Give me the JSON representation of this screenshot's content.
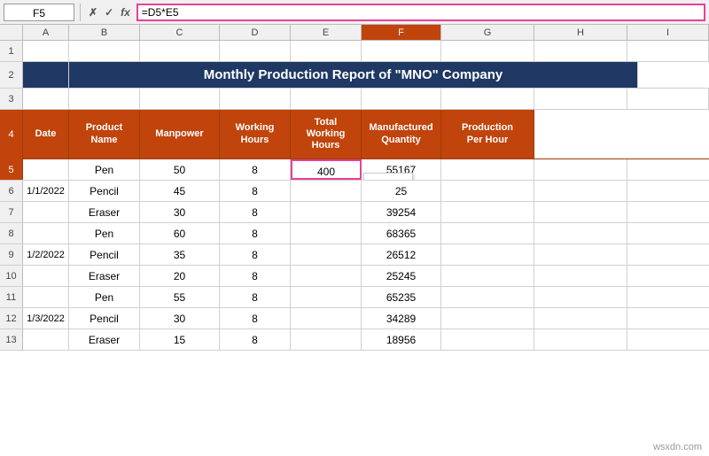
{
  "namebox": {
    "value": "F5"
  },
  "formulabar": {
    "value": "=D5*E5"
  },
  "title": {
    "text": "Monthly Production Report of \"MNO\" Company"
  },
  "headers": {
    "colLetters": [
      "",
      "A",
      "B",
      "C",
      "D",
      "E",
      "F",
      "G",
      "H",
      "I"
    ],
    "date": "Date",
    "productName": "Product\nName",
    "manpower": "Manpower",
    "workingHours": "Working\nHours",
    "totalWorkingHours": "Total\nWorking\nHours",
    "manufacturedQty": "Manufactured\nQuantity",
    "productionPerHour": "Production\nPer Hour"
  },
  "rows": [
    {
      "rowNum": "1",
      "date": "",
      "product": "",
      "manpower": "",
      "workingHours": "",
      "totalWH": "",
      "mfgQty": "",
      "prodPH": ""
    },
    {
      "rowNum": "2",
      "isTitle": true
    },
    {
      "rowNum": "3",
      "date": "",
      "product": "",
      "manpower": "",
      "workingHours": "",
      "totalWH": "",
      "mfgQty": "",
      "prodPH": ""
    },
    {
      "rowNum": "4",
      "isHeader": true
    },
    {
      "rowNum": "5",
      "date": "",
      "product": "Pen",
      "manpower": "50",
      "workingHours": "8",
      "totalWH": "400",
      "mfgQty": "55167",
      "prodPH": "",
      "selectedF": true,
      "showPaste": true
    },
    {
      "rowNum": "6",
      "date": "1/1/2022",
      "product": "Pencil",
      "manpower": "45",
      "workingHours": "8",
      "totalWH": "",
      "mfgQty": "25",
      "prodPH": ""
    },
    {
      "rowNum": "7",
      "date": "",
      "product": "Eraser",
      "manpower": "30",
      "workingHours": "8",
      "totalWH": "",
      "mfgQty": "39254",
      "prodPH": ""
    },
    {
      "rowNum": "8",
      "date": "",
      "product": "Pen",
      "manpower": "60",
      "workingHours": "8",
      "totalWH": "",
      "mfgQty": "68365",
      "prodPH": ""
    },
    {
      "rowNum": "9",
      "date": "1/2/2022",
      "product": "Pencil",
      "manpower": "35",
      "workingHours": "8",
      "totalWH": "",
      "mfgQty": "26512",
      "prodPH": ""
    },
    {
      "rowNum": "10",
      "date": "",
      "product": "Eraser",
      "manpower": "20",
      "workingHours": "8",
      "totalWH": "",
      "mfgQty": "25245",
      "prodPH": ""
    },
    {
      "rowNum": "11",
      "date": "",
      "product": "Pen",
      "manpower": "55",
      "workingHours": "8",
      "totalWH": "",
      "mfgQty": "65235",
      "prodPH": ""
    },
    {
      "rowNum": "12",
      "date": "1/3/2022",
      "product": "Pencil",
      "manpower": "30",
      "workingHours": "8",
      "totalWH": "",
      "mfgQty": "34289",
      "prodPH": ""
    },
    {
      "rowNum": "13",
      "date": "",
      "product": "Eraser",
      "manpower": "15",
      "workingHours": "8",
      "totalWH": "",
      "mfgQty": "18956",
      "prodPH": ""
    }
  ],
  "watermark": "wsxdn.com",
  "pasteTooltip": "📋(Ctrl)·⊞"
}
